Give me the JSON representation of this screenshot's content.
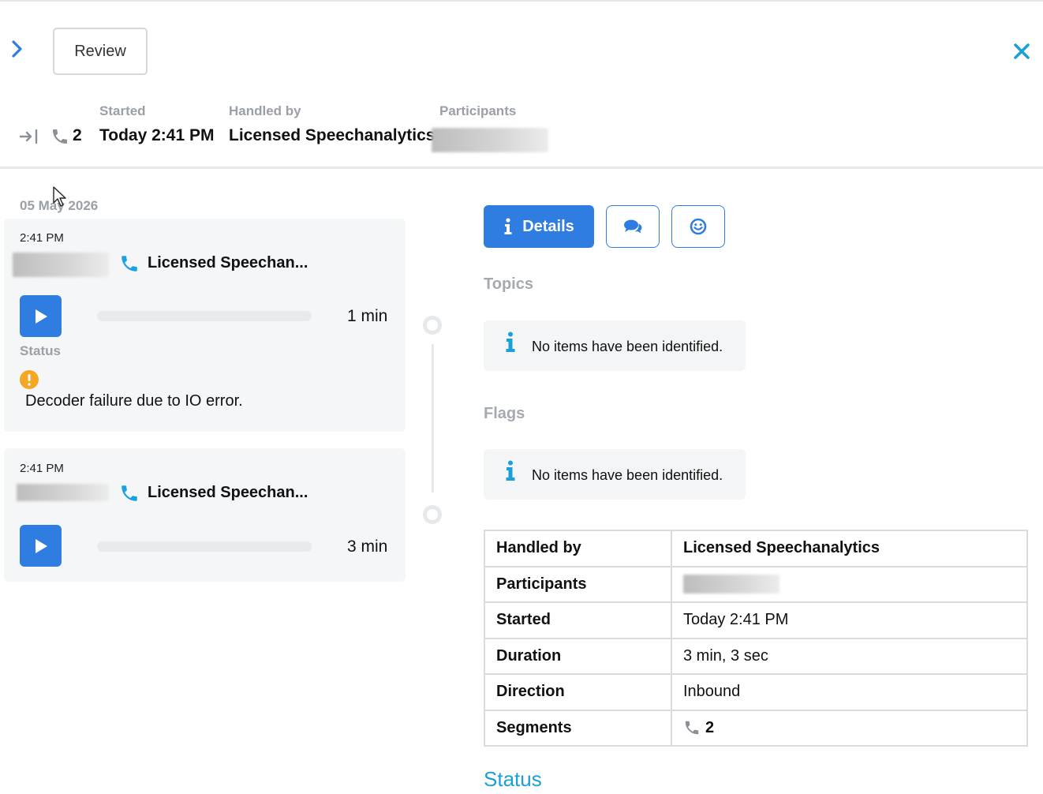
{
  "header": {
    "review_label": "Review",
    "segments_count": "2",
    "started_label": "Started",
    "started_value": "Today 2:41 PM",
    "handled_by_label": "Handled by",
    "handled_by_value": "Licensed Speechanalytics",
    "participants_label": "Participants"
  },
  "timeline": {
    "date": "05 May 2026",
    "segments": [
      {
        "time": "2:41 PM",
        "name": "Licensed Speechan...",
        "duration": "1 min",
        "status_label": "Status",
        "status_text": "Decoder failure due to IO error."
      },
      {
        "time": "2:41 PM",
        "name": "Licensed Speechan...",
        "duration": "3 min"
      }
    ]
  },
  "tabs": {
    "details_label": "Details",
    "transcript_icon": "chat-bubbles-icon",
    "sentiment_icon": "smiley-icon"
  },
  "topics": {
    "label": "Topics",
    "message": "No items have been identified."
  },
  "flags": {
    "label": "Flags",
    "message": "No items have been identified."
  },
  "details_table": {
    "handled_by_key": "Handled by",
    "handled_by_val": "Licensed Speechanalytics",
    "participants_key": "Participants",
    "started_key": "Started",
    "started_val": "Today 2:41 PM",
    "duration_key": "Duration",
    "duration_val": "3 min, 3 sec",
    "direction_key": "Direction",
    "direction_val": "Inbound",
    "segments_key": "Segments",
    "segments_val": "2"
  },
  "status_heading": "Status",
  "colors": {
    "accent_blue": "#2f7de1",
    "close_blue": "#1b9fd9",
    "phone_cyan": "#1ba1e2",
    "warning": "#f5a623",
    "muted_label": "#9aa0a6"
  }
}
